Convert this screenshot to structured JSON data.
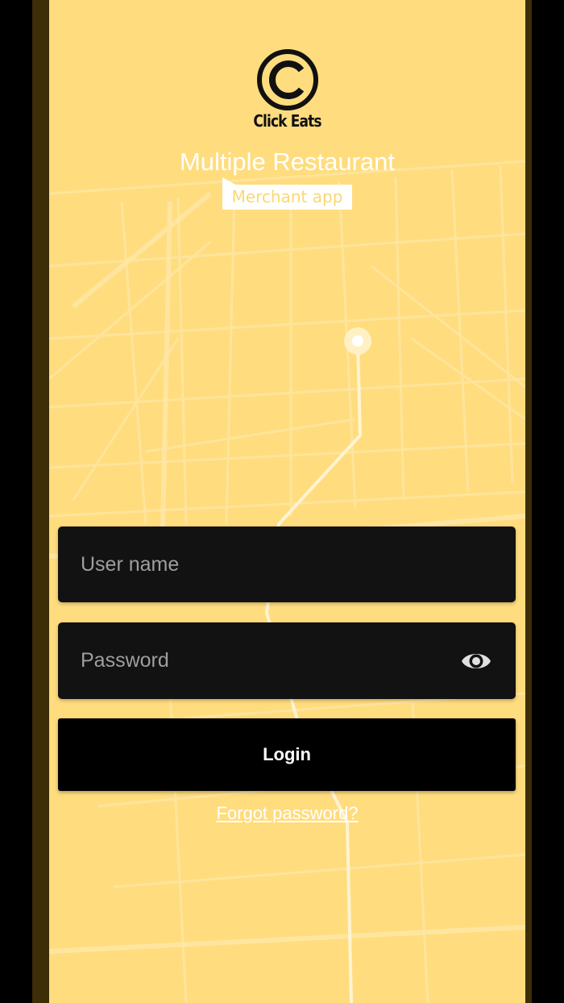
{
  "app": {
    "brand_name": "Click Eats",
    "title": "Multiple Restaurant",
    "subtitle_badge": "Merchant app"
  },
  "form": {
    "username_placeholder": "User name",
    "password_placeholder": "Password",
    "login_label": "Login",
    "forgot_label": "Forgot password?"
  },
  "icons": {
    "logo": "copyright-c-logo-icon",
    "password_toggle": "eye-icon"
  },
  "colors": {
    "background": "#ffdc7e",
    "frame": "#3d2e08",
    "field_background": "#121212",
    "button_background": "#000000",
    "badge_text": "#f9d873",
    "text_light": "#ffffff",
    "placeholder_text": "#9e9e9e"
  }
}
